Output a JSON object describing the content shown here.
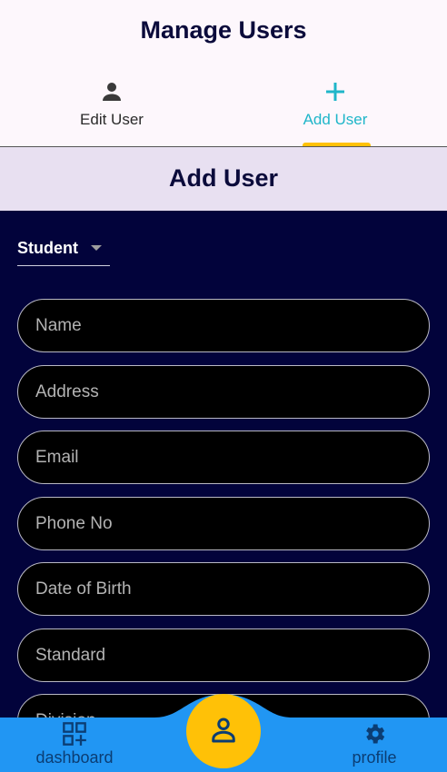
{
  "header": {
    "title": "Manage Users"
  },
  "tabs": [
    {
      "label": "Edit User",
      "icon": "person-icon"
    },
    {
      "label": "Add User",
      "icon": "plus-icon"
    }
  ],
  "section": {
    "title": "Add User"
  },
  "form": {
    "role": {
      "selected": "Student"
    },
    "fields": [
      {
        "placeholder": "Name"
      },
      {
        "placeholder": "Address"
      },
      {
        "placeholder": "Email"
      },
      {
        "placeholder": "Phone No"
      },
      {
        "placeholder": "Date of Birth"
      },
      {
        "placeholder": "Standard"
      },
      {
        "placeholder": "Division"
      }
    ]
  },
  "nav": {
    "dashboard": {
      "label": "dashboard",
      "icon": "dashboard-add-icon"
    },
    "center": {
      "icon": "user-icon"
    },
    "profile": {
      "label": "profile",
      "icon": "gear-icon"
    }
  },
  "colors": {
    "accent": "#1fb6c9",
    "indicator": "#ffc107",
    "form_bg": "#02033b",
    "nav_bg": "#2196f3",
    "title": "#0b0b3b"
  }
}
